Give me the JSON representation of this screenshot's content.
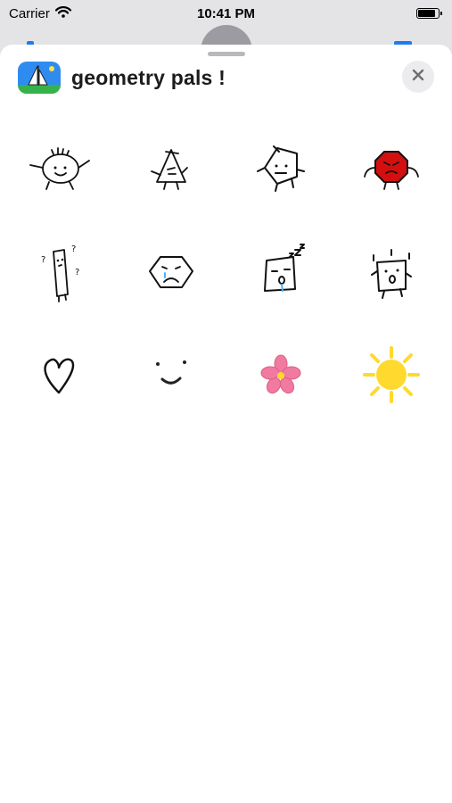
{
  "status_bar": {
    "carrier": "Carrier",
    "time": "10:41 PM",
    "wifi_icon": "wifi-icon",
    "battery_level": 0.9
  },
  "sheet": {
    "title": "geometry pals !",
    "app_icon": "sailboat-app-icon",
    "close_icon": "close-x-icon"
  },
  "stickers": [
    {
      "name": "round-pal-sticker"
    },
    {
      "name": "triangle-pal-sticker"
    },
    {
      "name": "pentagon-pal-sticker"
    },
    {
      "name": "angry-red-octagon-sticker"
    },
    {
      "name": "tall-rectangle-confused-sticker"
    },
    {
      "name": "sad-hexagon-sticker"
    },
    {
      "name": "sleepy-square-sticker"
    },
    {
      "name": "surprised-square-sticker"
    },
    {
      "name": "heart-sticker"
    },
    {
      "name": "smile-sticker"
    },
    {
      "name": "pink-flower-sticker"
    },
    {
      "name": "sun-sticker"
    }
  ],
  "colors": {
    "accent_blue": "#1d7cf2",
    "angry_red": "#d40f0f",
    "flower_pink": "#f07aa0",
    "sun_yellow": "#ffd92e",
    "tear_blue": "#4ab3ff"
  }
}
